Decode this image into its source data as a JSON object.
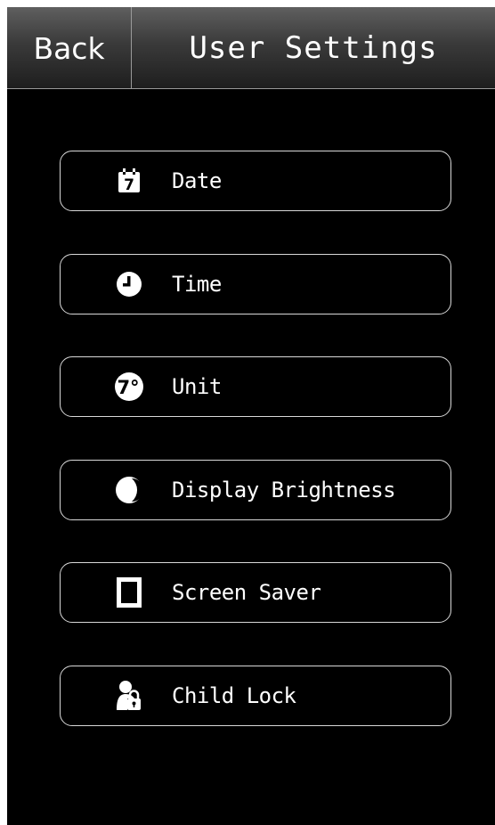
{
  "header": {
    "back_label": "Back",
    "title": "User Settings"
  },
  "menu": {
    "items": [
      {
        "label": "Date",
        "icon": "calendar-icon"
      },
      {
        "label": "Time",
        "icon": "clock-icon"
      },
      {
        "label": "Unit",
        "icon": "temperature-unit-icon",
        "icon_text": "7°"
      },
      {
        "label": "Display Brightness",
        "icon": "brightness-icon"
      },
      {
        "label": "Screen Saver",
        "icon": "screen-icon"
      },
      {
        "label": "Child Lock",
        "icon": "child-lock-icon"
      }
    ]
  },
  "calendar_day": "7",
  "colors": {
    "background": "#000000",
    "text": "#ffffff",
    "button_border": "#d8d8d8"
  }
}
